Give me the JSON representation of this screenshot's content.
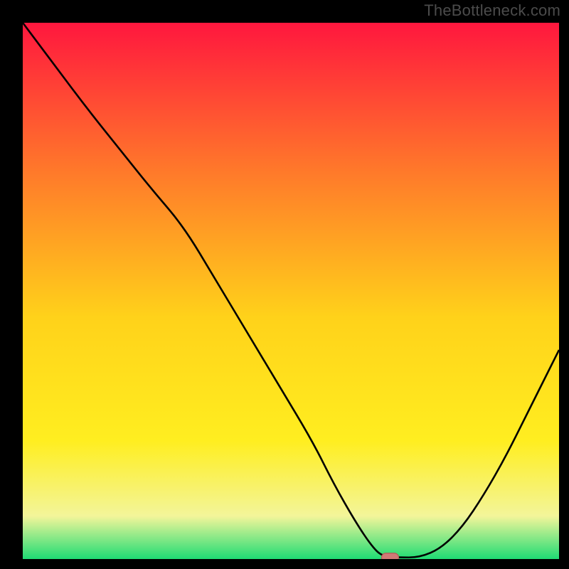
{
  "attribution": "TheBottleneck.com",
  "colors": {
    "frame_bg": "#000000",
    "gradient_top": "#ff173e",
    "gradient_mid1": "#ff7a2a",
    "gradient_mid2": "#ffd21a",
    "gradient_mid3": "#ffee20",
    "gradient_mid4": "#f3f59a",
    "gradient_bottom": "#1fdc74",
    "curve": "#000000",
    "marker_fill": "#d07a76",
    "marker_stroke": "#b65a55"
  },
  "chart_data": {
    "type": "line",
    "title": "",
    "xlabel": "",
    "ylabel": "",
    "xlim": [
      0,
      100
    ],
    "ylim": [
      0,
      100
    ],
    "grid": false,
    "series": [
      {
        "name": "bottleneck-curve",
        "x": [
          0,
          6,
          12,
          18,
          24,
          30,
          36,
          42,
          48,
          54,
          58,
          62,
          65,
          67,
          70,
          74,
          78,
          82,
          86,
          90,
          94,
          98,
          100
        ],
        "y": [
          100,
          92,
          84,
          76.5,
          69,
          62,
          52,
          42,
          32,
          22,
          14,
          7,
          2.5,
          0.5,
          0.3,
          0.3,
          2,
          6,
          12,
          19,
          27,
          35,
          39
        ]
      }
    ],
    "marker": {
      "x": 68.5,
      "y": 0.3
    }
  }
}
